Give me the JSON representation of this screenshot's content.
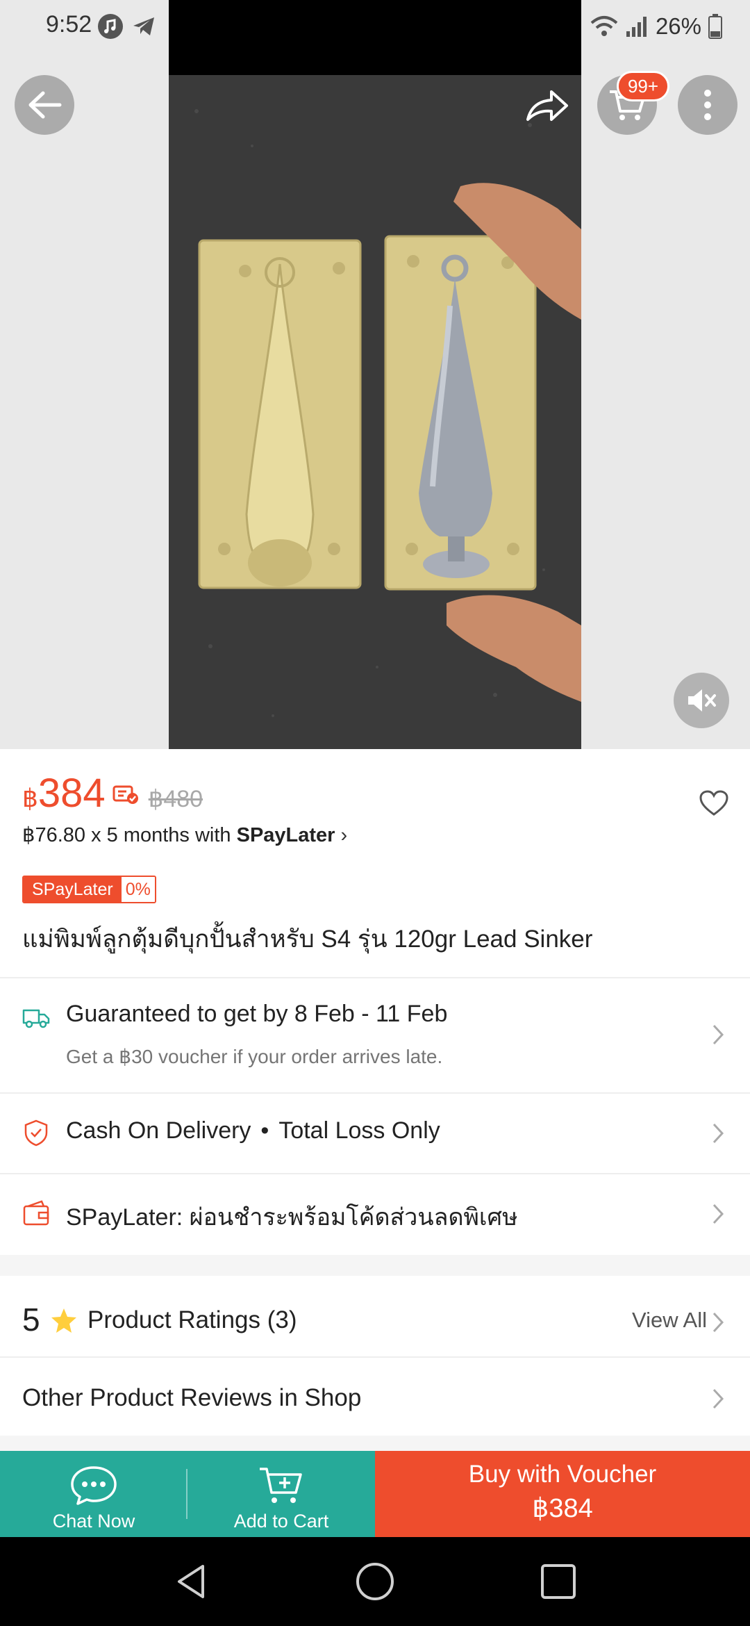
{
  "status_bar": {
    "time": "9:52",
    "battery": "26%",
    "icons": [
      "music-icon",
      "telegram-icon",
      "wifi-icon",
      "signal-icon",
      "battery-icon"
    ]
  },
  "header": {
    "cart_badge": "99+",
    "icons": [
      "back-arrow-icon",
      "share-icon",
      "cart-icon",
      "more-vertical-icon",
      "mute-icon"
    ]
  },
  "product": {
    "currency_symbol": "฿",
    "price": "384",
    "original_price": "฿480",
    "installment_prefix": "฿76.80 x 5 months with ",
    "installment_brand": "SPayLater",
    "spaylater_badge": "SPayLater",
    "spaylater_rate": "0%",
    "title": "แม่พิมพ์ลูกตุ้มดีบุกปั้นสำหรับ S4 รุ่น 120gr Lead Sinker"
  },
  "shipping": {
    "title": "Guaranteed to get by 8 Feb - 11 Feb",
    "subtitle": "Get a ฿30 voucher if your order arrives late."
  },
  "protection": {
    "cod": "Cash On Delivery",
    "separator": "•",
    "loss": "Total Loss Only"
  },
  "spaylater_promo": {
    "text": "SPayLater: ผ่อนชำระพร้อมโค้ดส่วนลดพิเศษ"
  },
  "ratings": {
    "score": "5",
    "label": "Product Ratings",
    "count": "(3)",
    "view_all": "View All"
  },
  "other_reviews": {
    "label": "Other Product Reviews in Shop"
  },
  "actions": {
    "chat_label": "Chat Now",
    "cart_label": "Add to Cart",
    "buy_label": "Buy with Voucher",
    "buy_price": "฿384"
  },
  "colors": {
    "brand": "#ee4d2d",
    "teal": "#26aa99",
    "star": "#ffce3d"
  }
}
